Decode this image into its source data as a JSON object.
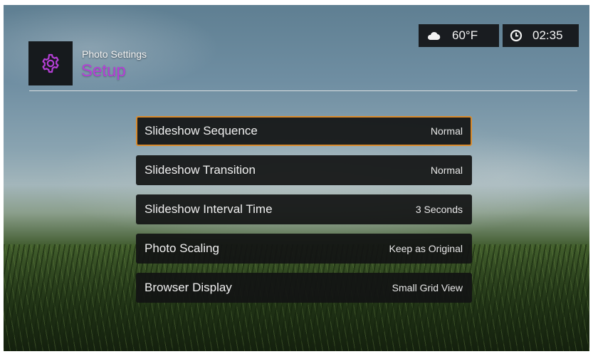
{
  "header": {
    "subtitle": "Photo Settings",
    "title": "Setup",
    "icon": "gear-icon",
    "accent_color": "#b53fd6"
  },
  "status": {
    "weather_icon": "cloud-icon",
    "temperature": "60°F",
    "clock_icon": "clock-icon",
    "time": "02:35"
  },
  "menu": {
    "selected_index": 0,
    "highlight_color": "#d98a2b",
    "items": [
      {
        "label": "Slideshow Sequence",
        "value": "Normal"
      },
      {
        "label": "Slideshow Transition",
        "value": "Normal"
      },
      {
        "label": "Slideshow Interval Time",
        "value": "3 Seconds"
      },
      {
        "label": "Photo Scaling",
        "value": "Keep as Original"
      },
      {
        "label": "Browser Display",
        "value": "Small Grid View"
      }
    ]
  }
}
